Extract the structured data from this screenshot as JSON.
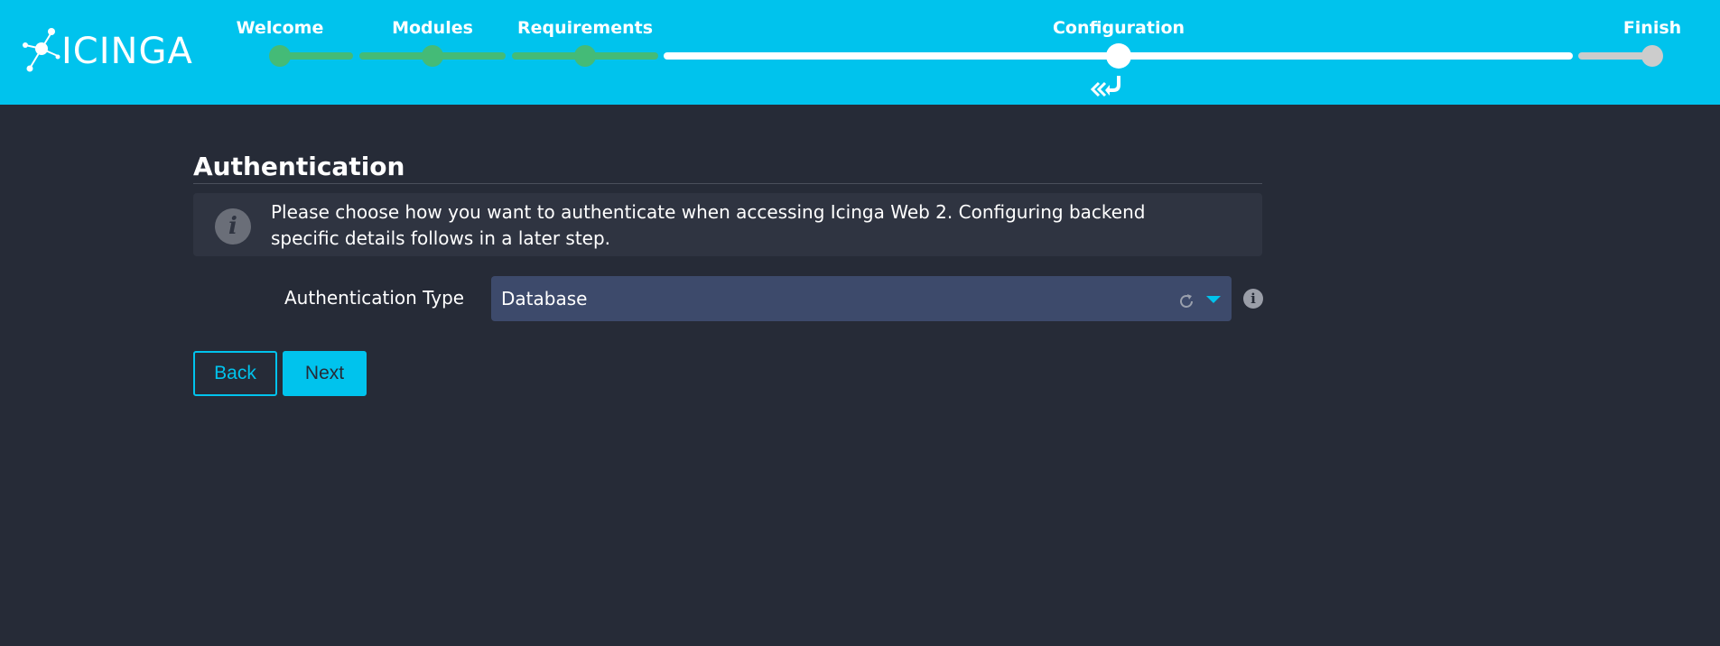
{
  "brand": {
    "logo_text": "ICINGA"
  },
  "wizard": {
    "steps": [
      {
        "label": "Welcome",
        "state": "done"
      },
      {
        "label": "Modules",
        "state": "done"
      },
      {
        "label": "Requirements",
        "state": "done"
      },
      {
        "label": "Configuration",
        "state": "current"
      },
      {
        "label": "Finish",
        "state": "todo"
      }
    ]
  },
  "page": {
    "title": "Authentication",
    "info_text": "Please choose how you want to authenticate when accessing Icinga Web 2. Configuring backend specific details follows in a later step."
  },
  "form": {
    "auth_type_label": "Authentication Type",
    "auth_type_value": "Database"
  },
  "buttons": {
    "back_label": "Back",
    "next_label": "Next"
  },
  "icons": {
    "logo": "icinga-logo-icon",
    "info": "info-icon",
    "help": "help-icon",
    "refresh": "refresh-icon",
    "caret": "chevron-down-icon",
    "return": "return-icon"
  },
  "colors": {
    "header": "#00c3ed",
    "background": "#262b37",
    "step_done": "#44bb77",
    "step_current": "#ffffff",
    "step_todo": "#cccccc",
    "select_bg": "#3d4a6b",
    "accent": "#00c3ed"
  }
}
